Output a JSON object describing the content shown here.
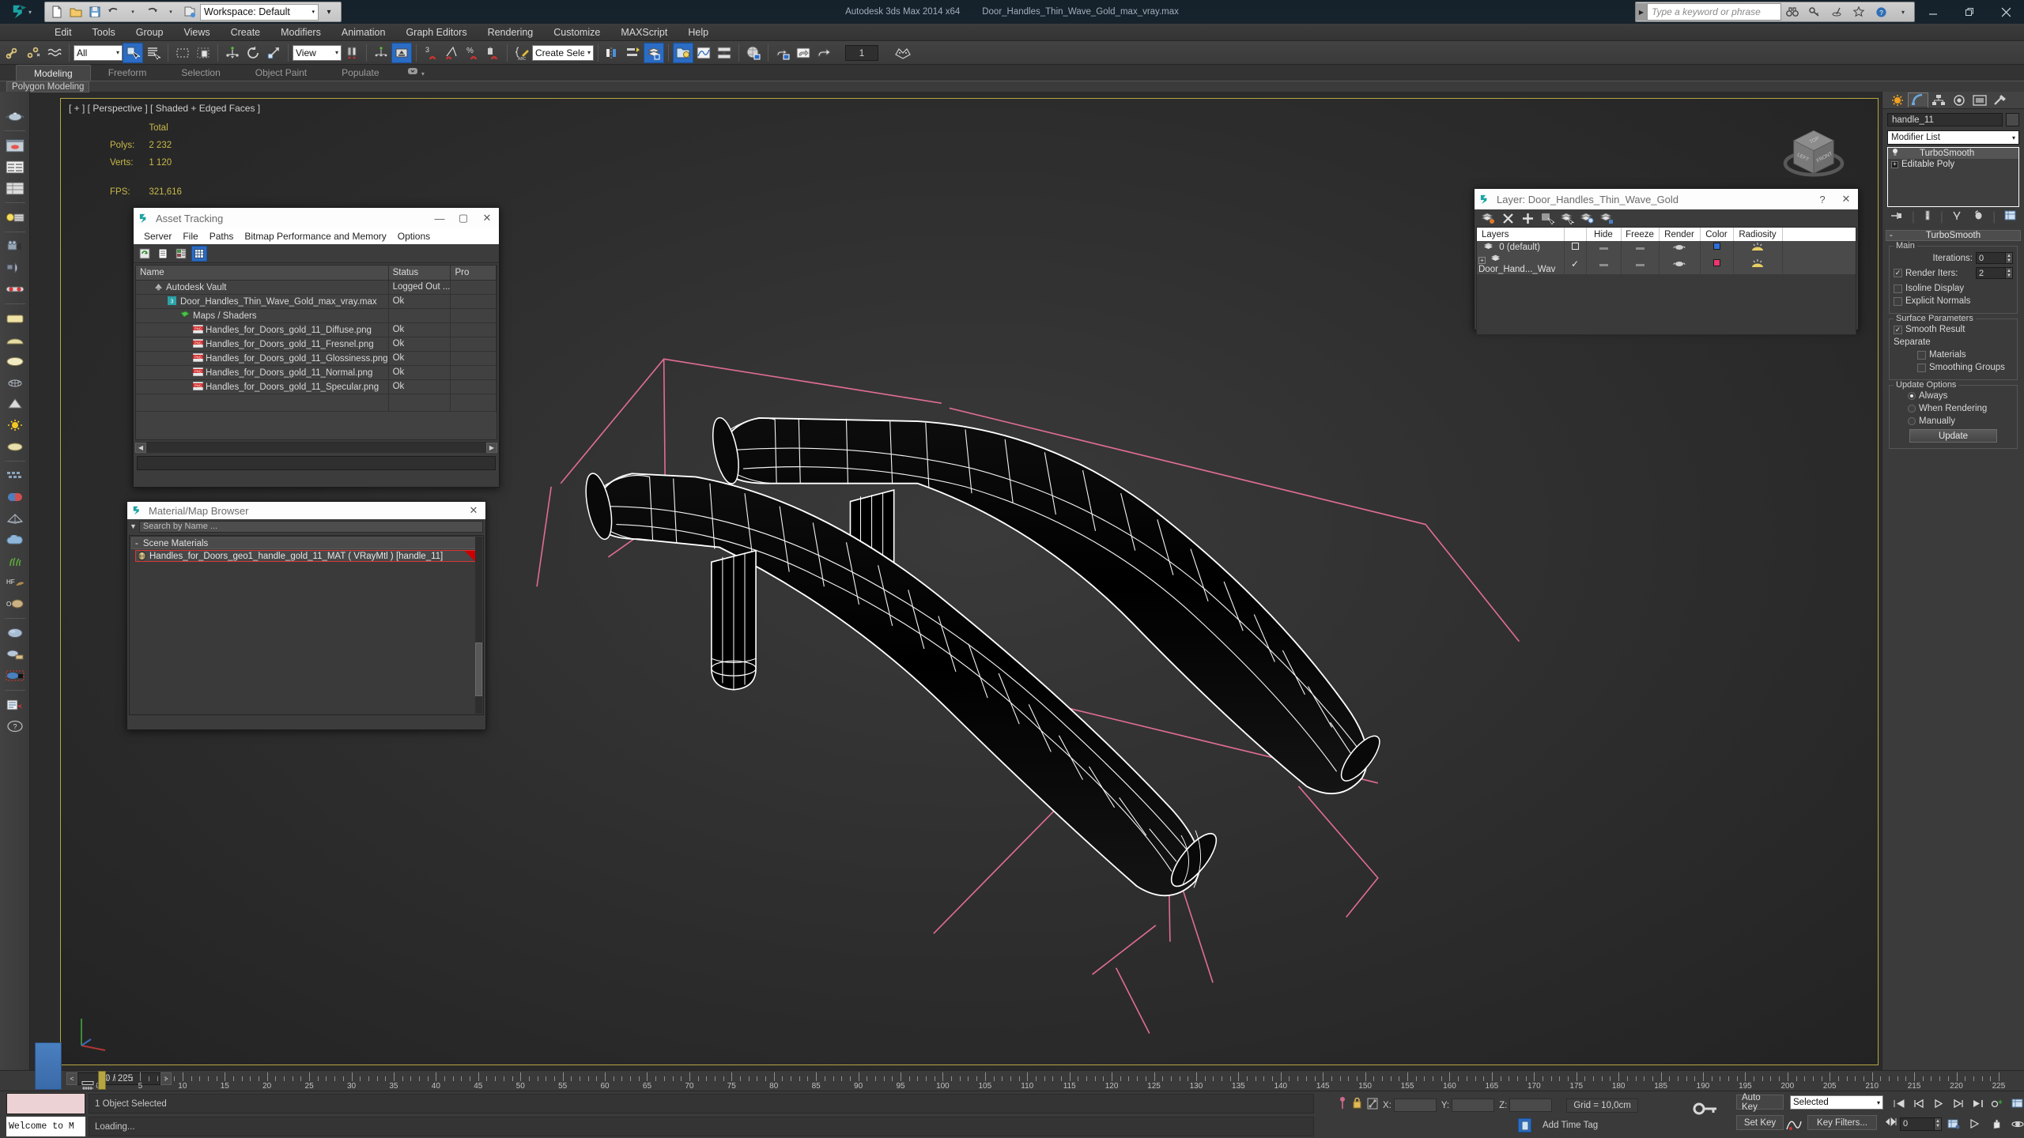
{
  "app": {
    "title_product": "Autodesk 3ds Max  2014 x64",
    "title_file": "Door_Handles_Thin_Wave_Gold_max_vray.max",
    "workspace_label": "Workspace: Default",
    "search_placeholder": "Type a keyword or phrase",
    "window_buttons": [
      "minimize",
      "restore",
      "close"
    ]
  },
  "menu": {
    "items": [
      "Edit",
      "Tools",
      "Group",
      "Views",
      "Create",
      "Modifiers",
      "Animation",
      "Graph Editors",
      "Rendering",
      "Customize",
      "MAXScript",
      "Help"
    ]
  },
  "toolbar": {
    "selection_filter": "All",
    "reference_coord": "View",
    "named_selection_sets": "Create Selection Se",
    "array_count": "1",
    "icons": [
      "select-link-icon",
      "unlink-icon",
      "bind-space-warp-icon",
      "select-object-icon",
      "select-by-name-icon",
      "rectangular-region-icon",
      "window-crossing-icon",
      "select-and-move-icon",
      "select-and-rotate-icon",
      "select-and-scale-icon",
      "use-pivot-center-icon",
      "use-selection-center-icon",
      "snap-toggle-icon",
      "angle-snap-icon",
      "percent-snap-icon",
      "spinner-snap-icon",
      "edit-named-selection-icon",
      "mirror-icon",
      "align-icon",
      "layer-manager-icon",
      "toggle-scene-explorer-icon",
      "curve-editor-icon",
      "schematic-view-icon",
      "material-editor-icon",
      "render-setup-icon",
      "rendered-frame-window-icon",
      "render-production-icon"
    ]
  },
  "ribbon": {
    "tabs": [
      "Modeling",
      "Freeform",
      "Selection",
      "Object Paint",
      "Populate"
    ],
    "active_tab": "Modeling",
    "panel_label": "Polygon Modeling"
  },
  "left_toolbar": {
    "icons": [
      "teapot-icon",
      "viewport-image-icon",
      "list-view-icon",
      "table-view-icon",
      "light-list-icon",
      "camera-icon",
      "camera-match-icon",
      "3d-glasses-icon",
      "plane-primitive-icon",
      "dome-icon",
      "ellipse-icon",
      "teapot-wire-icon",
      "cone-icon",
      "sun-icon",
      "disc-icon",
      "array-icon",
      "capsule-icon",
      "pyramid-wire-icon",
      "cloud-icon",
      "grass-icon",
      "hf-terrain-icon",
      "oxygen-icon",
      "sphere-icon",
      "material-preview-icon",
      "selection-region-icon",
      "notes-icon",
      "help-icon"
    ]
  },
  "viewport": {
    "label": "[ + ] [ Perspective ] [ Shaded + Edged Faces ]",
    "stats": {
      "header": "Total",
      "rows": [
        {
          "label": "Polys:",
          "value": "2 232"
        },
        {
          "label": "Verts:",
          "value": "1 120"
        }
      ],
      "fps_label": "FPS:",
      "fps_value": "321,616"
    },
    "viewcube_faces": [
      "TOP",
      "LEFT",
      "FRONT"
    ],
    "border_color": "#b5a642",
    "selection_bracket_color": "#e06c96"
  },
  "asset_tracking": {
    "title": "Asset Tracking",
    "menus": [
      "Server",
      "File",
      "Paths",
      "Bitmap Performance and Memory",
      "Options"
    ],
    "toolbar_icons": [
      "refresh-icon",
      "list-icon",
      "details-icon",
      "grid-icon"
    ],
    "columns": [
      "Name",
      "Status",
      "Pro"
    ],
    "rows": [
      {
        "indent": 0,
        "icon": "vault-icon",
        "name": "Autodesk Vault",
        "status": "Logged Out ..."
      },
      {
        "indent": 1,
        "icon": "max-file-icon",
        "name": "Door_Handles_Thin_Wave_Gold_max_vray.max",
        "status": "Ok"
      },
      {
        "indent": 2,
        "icon": "maps-shaders-icon",
        "name": "Maps / Shaders",
        "status": ""
      },
      {
        "indent": 3,
        "icon": "png-icon",
        "name": "Handles_for_Doors_gold_11_Diffuse.png",
        "status": "Ok"
      },
      {
        "indent": 3,
        "icon": "png-icon",
        "name": "Handles_for_Doors_gold_11_Fresnel.png",
        "status": "Ok"
      },
      {
        "indent": 3,
        "icon": "png-icon",
        "name": "Handles_for_Doors_gold_11_Glossiness.png",
        "status": "Ok"
      },
      {
        "indent": 3,
        "icon": "png-icon",
        "name": "Handles_for_Doors_gold_11_Normal.png",
        "status": "Ok"
      },
      {
        "indent": 3,
        "icon": "png-icon",
        "name": "Handles_for_Doors_gold_11_Specular.png",
        "status": "Ok"
      },
      {
        "indent": 0,
        "icon": "",
        "name": "",
        "status": ""
      }
    ]
  },
  "material_browser": {
    "title": "Material/Map Browser",
    "search_placeholder": "Search by Name ...",
    "group_label": "Scene Materials",
    "group_toggle": "-",
    "material_name": "Handles_for_Doors_geo1_handle_gold_11_MAT ( VRayMtl ) [handle_11]"
  },
  "layer_dialog": {
    "title": "Layer: Door_Handles_Thin_Wave_Gold",
    "help_glyph": "?",
    "close_glyph": "✕",
    "toolbar_icons": [
      "create-new-layer-icon",
      "delete-layer-icon",
      "add-selection-icon",
      "select-objects-icon",
      "select-highlighted-icon",
      "highlight-selected-icon",
      "hide-unselected-icon"
    ],
    "columns": [
      "Layers",
      "",
      "Hide",
      "Freeze",
      "Render",
      "Color",
      "Radiosity"
    ],
    "rows": [
      {
        "name": "0 (default)",
        "current": "box",
        "hide": "—",
        "freeze": "—",
        "render": "teapot-icon",
        "color": "#2c6fd6",
        "radiosity": "radiosity-icon"
      },
      {
        "name": "Door_Hand..._Wav",
        "current": "check",
        "hide": "—",
        "freeze": "—",
        "render": "teapot-icon",
        "color": "#e8386f",
        "radiosity": "radiosity-icon",
        "expandable": true
      }
    ]
  },
  "command_panel": {
    "tabs": [
      "create-tab",
      "modify-tab",
      "hierarchy-tab",
      "motion-tab",
      "display-tab",
      "utilities-tab"
    ],
    "active_tab_index": 1,
    "object_name": "handle_11",
    "modifier_list_label": "Modifier List",
    "stack": [
      {
        "label": "TurboSmooth",
        "selected": true,
        "icon": "lightbulb-icon"
      },
      {
        "label": "Editable Poly",
        "selected": false,
        "icon": "plus-box-icon"
      }
    ],
    "stack_buttons": [
      "pin-stack-icon",
      "show-end-result-icon",
      "make-unique-icon",
      "remove-modifier-icon",
      "configure-sets-icon"
    ],
    "rollout": {
      "title": "TurboSmooth",
      "collapse_glyph": "-",
      "groups": [
        {
          "title": "Main",
          "fields": [
            {
              "type": "spinner",
              "label": "Iterations:",
              "value": "0"
            },
            {
              "type": "checkbox-spinner",
              "label": "Render Iters:",
              "value": "2",
              "checked": true
            },
            {
              "type": "checkbox",
              "label": "Isoline Display",
              "checked": false
            },
            {
              "type": "checkbox",
              "label": "Explicit Normals",
              "checked": false
            }
          ]
        },
        {
          "title": "Surface Parameters",
          "fields": [
            {
              "type": "checkbox",
              "label": "Smooth Result",
              "checked": true
            },
            {
              "type": "text",
              "label": "Separate"
            },
            {
              "type": "checkbox-indent",
              "label": "Materials",
              "checked": false
            },
            {
              "type": "checkbox-indent",
              "label": "Smoothing Groups",
              "checked": false
            }
          ]
        },
        {
          "title": "Update Options",
          "fields": [
            {
              "type": "radio",
              "label": "Always",
              "checked": true
            },
            {
              "type": "radio",
              "label": "When Rendering",
              "checked": false
            },
            {
              "type": "radio",
              "label": "Manually",
              "checked": false
            },
            {
              "type": "button",
              "label": "Update"
            }
          ]
        }
      ]
    }
  },
  "timeline": {
    "current_frame_display": "0 / 225",
    "prev_glyph": "<",
    "next_glyph": ">",
    "tick_labels": [
      "0",
      "5",
      "10",
      "15",
      "20",
      "25",
      "30",
      "35",
      "40",
      "45",
      "50",
      "55",
      "60",
      "65",
      "70",
      "75",
      "80",
      "85",
      "90",
      "95",
      "100",
      "105",
      "110",
      "115",
      "120",
      "125",
      "130",
      "135",
      "140",
      "145",
      "150",
      "155",
      "160",
      "165",
      "170",
      "175",
      "180",
      "185",
      "190",
      "195",
      "200",
      "205",
      "210",
      "215",
      "220",
      "225"
    ],
    "range_start": 0,
    "range_end": 225
  },
  "status_bar": {
    "maxscript_listener_text": "Welcome to M",
    "selection_status": "1 Object Selected",
    "prompt": "Loading...",
    "coord_labels": [
      "X:",
      "Y:",
      "Z:"
    ],
    "coord_values": [
      "",
      "",
      ""
    ],
    "grid_label": "Grid = 10,0cm",
    "add_time_tag": "Add Time Tag",
    "auto_key": "Auto Key",
    "set_key": "Set Key",
    "key_mode": "Selected",
    "key_filters": "Key Filters...",
    "key_spinner_value": "0",
    "nav_icons": [
      "zoom-icon",
      "zoom-all-icon",
      "zoom-extents-icon",
      "zoom-region-icon",
      "pan-icon",
      "orbit-icon",
      "maximize-viewport-icon"
    ],
    "playback_icons": [
      "go-to-start-icon",
      "previous-frame-icon",
      "play-icon",
      "next-frame-icon",
      "go-to-end-icon",
      "key-mode-icon",
      "time-config-icon",
      "pan-tool-icon",
      "zoom-tool-icon"
    ]
  }
}
